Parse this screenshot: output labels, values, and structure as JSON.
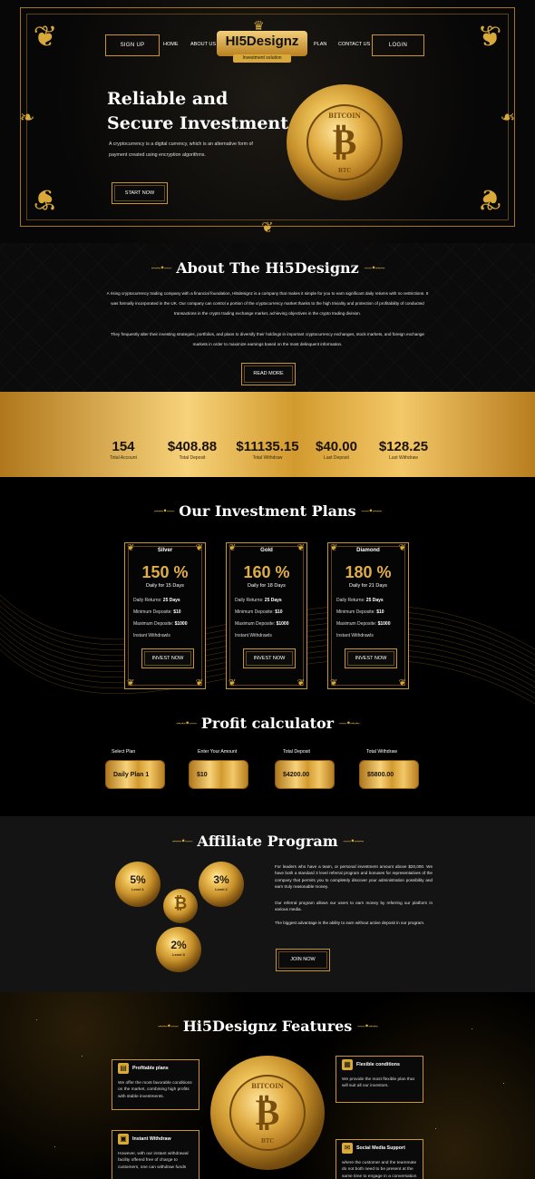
{
  "nav": {
    "signup": "SIGN UP",
    "home": "HOME",
    "about": "ABOUT US",
    "plan": "PLAN",
    "contact": "CONTACT US",
    "login": "LOGIN"
  },
  "logo": {
    "name": "HI5Designz",
    "tagline": "Investment solution"
  },
  "hero": {
    "title_line1": "Reliable and",
    "title_line2": "Secure Investment",
    "description": "A cryptocurrency is a digital currency, which is an alternative form of payment created using encryption algorithms.",
    "cta": "START NOW",
    "coin_top": "BITCOIN",
    "coin_bottom": "BTC"
  },
  "about": {
    "title": "About The Hi5Designz",
    "p1": "A rising cryptocurrency trading company with a financial foundation, Hi5designz is a company that makes it simple for you to earn significant daily returns with no restrictions. It was formally incorporated in the UK. Our company can control a portion of the cryptocurrency market thanks to the high triviality and protection of profitability of conducted transactions in the crypto trading exchange market, achieving objectives in the crypto trading division.",
    "p2": "They frequently alter their investing strategies, portfolios, and plans to diversify their holdings in important cryptocurrency exchanges, stock markets, and foreign exchange markets in order to maximize earnings based on the most delinquent information.",
    "cta": "READ MORE"
  },
  "stats": [
    {
      "value": "154",
      "label": "Total Account"
    },
    {
      "value": "$408.88",
      "label": "Total Deposit"
    },
    {
      "value": "$11135.15",
      "label": "Total Withdraw"
    },
    {
      "value": "$40.00",
      "label": "Last Deposit"
    },
    {
      "value": "$128.25",
      "label": "Last Withdraw"
    }
  ],
  "plans": {
    "title": "Our Investment Plans",
    "items": [
      {
        "name": "Silver",
        "percent": "150 %",
        "days": "Daily for 15 Days",
        "returns_label": "Daily Returns:",
        "returns": "25 Days",
        "min_label": "Minimum Deposite:",
        "min": "$10",
        "max_label": "Maximum Deposite:",
        "max": "$1000",
        "withdraw": "Instant Withdrawls",
        "cta": "INVEST NOW"
      },
      {
        "name": "Gold",
        "percent": "160 %",
        "days": "Daily for 18 Days",
        "returns_label": "Daily Returns:",
        "returns": "25 Days",
        "min_label": "Minimum Deposite:",
        "min": "$10",
        "max_label": "Maximum Deposite:",
        "max": "$1000",
        "withdraw": "Instant Withdrawls",
        "cta": "INVEST NOW"
      },
      {
        "name": "Diamond",
        "percent": "180 %",
        "days": "Daily for 21 Days",
        "returns_label": "Daily Returns:",
        "returns": "25 Days",
        "min_label": "Minimum Deposite:",
        "min": "$10",
        "max_label": "Maximum Deposite:",
        "max": "$1000",
        "withdraw": "Instant Withdrawls",
        "cta": "INVEST NOW"
      }
    ]
  },
  "calculator": {
    "title": "Profit calculator",
    "fields": [
      {
        "label": "Select Plan",
        "value": "Daily Plan 1"
      },
      {
        "label": "Enter Your Amount",
        "value": "$10"
      },
      {
        "label": "Total Deposit",
        "value": "$4200.00"
      },
      {
        "label": "Total Withdraw",
        "value": "$5800.00"
      }
    ]
  },
  "affiliate": {
    "title": "Affiliate Program",
    "levels": [
      {
        "pct": "5%",
        "label": "Level 1"
      },
      {
        "pct": "3%",
        "label": "Level 2"
      },
      {
        "pct": "2%",
        "label": "Level 3"
      }
    ],
    "p1": "For leaders who have a team, or personal investment amount above $20,000. We have both a standard 3 level referral program and bonuses for representatives of the company that permits you to completely discover your administration possibility and earn truly reasonable money.",
    "p2": "Our referral program allows our users to earn money by referring our platform in various media.",
    "p3": "The biggest advantage is the ability to earn without active deposit in our program.",
    "cta": "JOIN NOW"
  },
  "features": {
    "title": "Hi5Designz Features",
    "items": [
      {
        "title": "Profitable plans",
        "desc": "We offer the most favorable conditions on the market, combining high profits with stable investments."
      },
      {
        "title": "Flexible conditions",
        "desc": "We provide the most flexible plan that will suit all our investors."
      },
      {
        "title": "Instant Withdraw",
        "desc": "However, with our instant withdrawal facility offered free of charge to customers, one can withdraw funds"
      },
      {
        "title": "Social Media Support",
        "desc": "where the customer and the teammate do not both need to be present at the same time to engage in a conversation"
      }
    ]
  },
  "colors": {
    "gold": "#d9a93a",
    "background": "#000000"
  }
}
